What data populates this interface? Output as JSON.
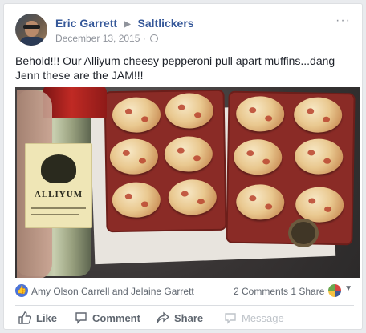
{
  "post": {
    "author": "Eric Garrett",
    "group": "Saltlickers",
    "date": "December 13, 2015",
    "date_suffix": "·",
    "more_label": "···",
    "text": "Behold!!! Our Alliyum cheesy pepperoni pull apart muffins...dang Jenn these are the JAM!!!"
  },
  "photo": {
    "label_brand": "ALLIYUM"
  },
  "engagement": {
    "reactors": "Amy Olson Carrell and Jelaine Garrett",
    "comments": "2 Comments",
    "shares": "1 Share",
    "reaction_icon": "thumbs-up-icon"
  },
  "actions": {
    "like": "Like",
    "comment": "Comment",
    "share": "Share",
    "message": "Message"
  },
  "colors": {
    "link": "#365899",
    "like_blue": "#4c74d7",
    "muted": "#90949c"
  }
}
